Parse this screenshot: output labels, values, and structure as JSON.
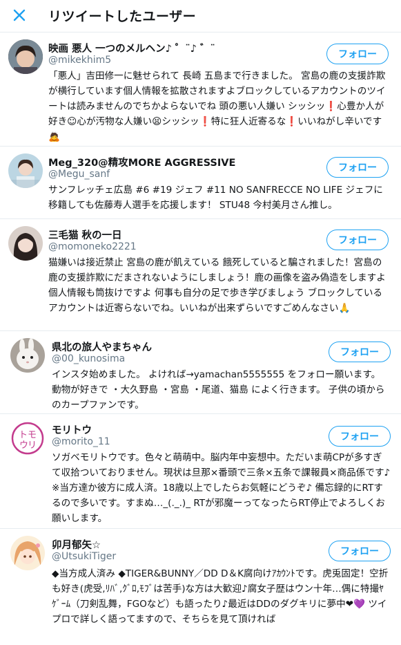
{
  "header": {
    "title": "リツイートしたユーザー",
    "close_icon": "close-icon"
  },
  "follow_label": "フォロー",
  "accent_color": "#1da1f2",
  "users": [
    {
      "name": "映画 悪人 一つのメルヘン♪ ゜¨♪ ゛¨",
      "handle": "@mikekhim5",
      "bio": "「悪人」吉田修一に魅せられて 長崎 五島まで行きました。 宮島の鹿の支援詐欺が横行しています個人情報を拡散されますよブロックしているアカウントのツイートは読みませんのでちかよらないでね 頭の悪い人嫌い シッシッ❗心豊か人が好き☺心が汚物な人嫌い😫シッシッ❗特に狂人近寄るな❗いいねがし辛いです🙇"
    },
    {
      "name": "Meg_320@精攻MORE AGGRESSIVE",
      "handle": "@Megu_sanf",
      "bio": "サンフレッチェ広島 #6 #19 ジェフ #11 NO SANFRECCE NO LIFE ジェフに移籍しても佐藤寿人選手を応援します！ STU48 今村美月さん推し。"
    },
    {
      "name": "三毛猫 秋の一日",
      "handle": "@momoneko2221",
      "bio": "猫嫌いは接近禁止 宮島の鹿が飢えている 餓死していると騙されました！宮島の鹿の支援詐欺にだまされないようにしましょう！鹿の画像を盗み偽造をしますよ 個人情報も筒抜けですよ 何事も自分の足で歩き学びましょう ブロックしているアカウントは近寄らないでね。いいねが出来ずらいですごめんなさい🙏"
    },
    {
      "name": "県北の旅人やまちゃん",
      "handle": "@00_kunosima",
      "bio": "インスタ始めました。 よければ→yamachan5555555 をフォロー願います。 動物が好きで ・大久野島 ・宮島 ・尾道、猫島 によく行きます。 子供の頃からのカープファンです。"
    },
    {
      "name": "モリトウ",
      "handle": "@morito_11",
      "bio": "ソガベモリトウです。色々と萌萌中。脳内年中妄想中。ただいま萌CPが多すぎて収拾ついておりません。現状は旦那×番頭で三条×五条で課報員×商品係です♪ ※当方達か彼方に成人済。18歳以上でしたらお気軽にどうぞ♪ 備忘録的にRTするので多いです。すまぬ…_(._.)_ RTが邪魔ーってなったらRT停止でよろしくお願いします。"
    },
    {
      "name": "卯月郁矢☆",
      "handle": "@UtsukiTiger",
      "bio": "◆当方成人済み ◆TIGER&BUNNY／DD D＆K腐向けｱｶｳﾝﾄです。虎兎固定！空折も好き(虎受,ﾘﾊﾞ,ｸﾞﾛ,ﾓﾌﾞは苦手)な方は大歓迎♪腐女子歴はウン十年…偶に特撮ﾔｹﾞｰﾑ（刀剣乱舞，FGOなど）も語ったり♪最近はDDのダグキリに夢中❤💜 ツイプロで詳しく語ってますので、そちらを見て頂ければ"
    }
  ]
}
